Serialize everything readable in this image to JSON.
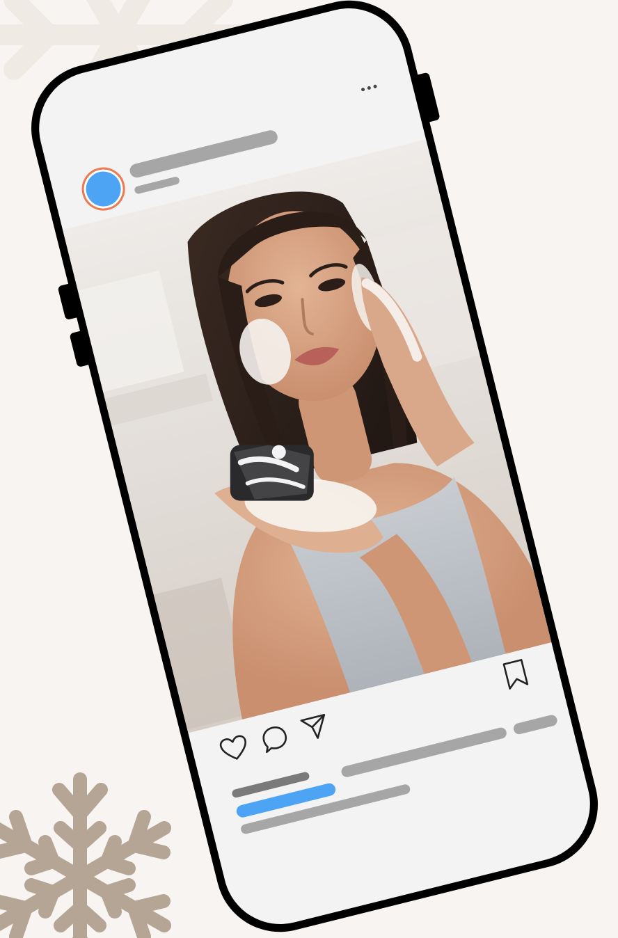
{
  "post": {
    "more_label": "...",
    "actions": {
      "like_icon": "heart-outline-icon",
      "comment_icon": "comment-bubble-icon",
      "share_icon": "paper-plane-icon",
      "save_icon": "bookmark-outline-icon"
    }
  },
  "colors": {
    "background": "#f8f4f1",
    "phone_frame": "#000000",
    "screen": "#f3f3f3",
    "avatar_fill": "#4da3f4",
    "avatar_ring": "#f07a50",
    "placeholder": "#a6a6a6",
    "placeholder_dark": "#7a7a7a",
    "accent_bar": "#4da3f4",
    "snowflake": "#b5a594"
  }
}
